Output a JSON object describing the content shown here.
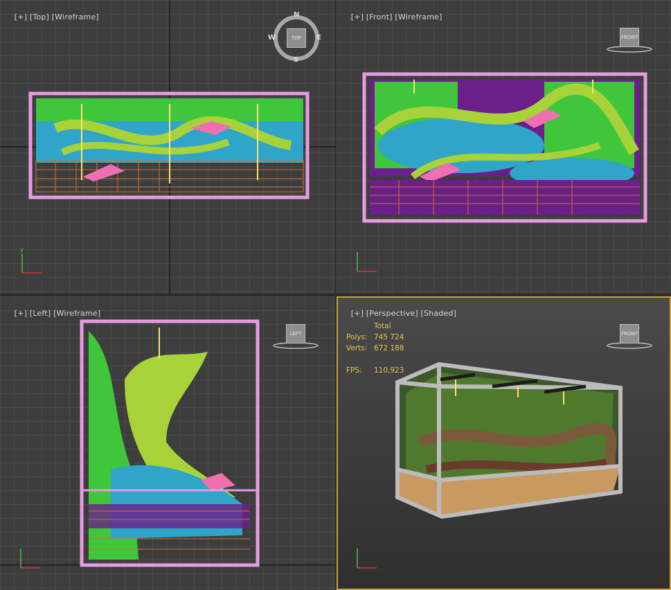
{
  "viewports": [
    {
      "id": "top",
      "labels": [
        "[+]",
        "[Top]",
        "[Wireframe]"
      ],
      "viewcube": "TOP",
      "compass": {
        "n": "N",
        "s": "S",
        "e": "E",
        "w": "W"
      }
    },
    {
      "id": "front",
      "labels": [
        "[+]",
        "[Front]",
        "[Wireframe]"
      ],
      "viewcube": "FRONT"
    },
    {
      "id": "left",
      "labels": [
        "[+]",
        "[Left]",
        "[Wireframe]"
      ],
      "viewcube": "LEFT"
    },
    {
      "id": "perspective",
      "labels": [
        "[+]",
        "[Perspective]",
        "[Shaded]"
      ],
      "viewcube": "FRONT"
    }
  ],
  "stats": {
    "header": "Total",
    "polys_label": "Polys:",
    "polys": "745 724",
    "verts_label": "Verts:",
    "verts": "672 188",
    "fps_label": "FPS:",
    "fps": "110,923"
  },
  "axes": {
    "x": "x",
    "y": "y",
    "z": "z"
  },
  "colors": {
    "wire_pink": "#e79be0",
    "green": "#3fc63a",
    "lime": "#a8d23a",
    "cyan": "#2fa5c9",
    "purple": "#6a1f8a",
    "orange": "#d0732a",
    "accent": "#c9a23a"
  }
}
